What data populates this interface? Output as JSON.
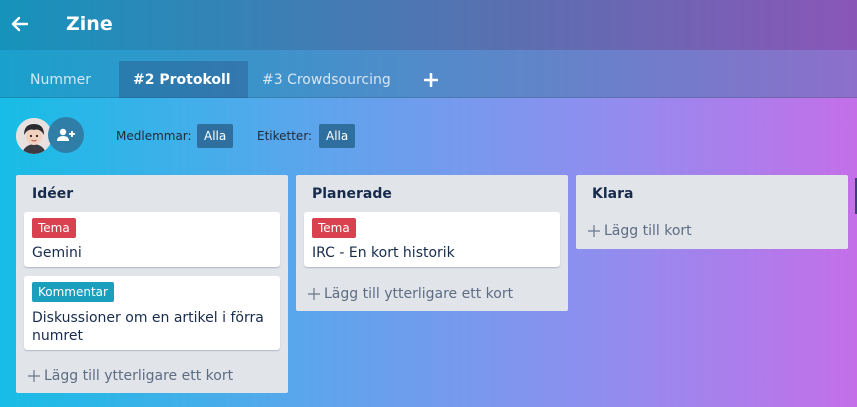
{
  "header": {
    "title": "Zine"
  },
  "tabs": [
    {
      "label": "Nummer",
      "active": false
    },
    {
      "label": "#2 Protokoll",
      "active": true
    },
    {
      "label": "#3 Crowdsourcing",
      "active": false
    }
  ],
  "filters": {
    "members_label": "Medlemmar:",
    "members_value": "Alla",
    "labels_label": "Etiketter:",
    "labels_value": "Alla"
  },
  "lists": [
    {
      "title": "Idéer",
      "cards": [
        {
          "label": "Tema",
          "label_color": "#d9414f",
          "title": "Gemini"
        },
        {
          "label": "Kommentar",
          "label_color": "#1a9fbd",
          "title": "Diskussioner om en artikel i förra numret"
        }
      ],
      "add_label": "Lägg till ytterligare ett kort"
    },
    {
      "title": "Planerade",
      "cards": [
        {
          "label": "Tema",
          "label_color": "#d9414f",
          "title": "IRC - En kort historik"
        }
      ],
      "add_label": "Lägg till ytterligare ett kort"
    },
    {
      "title": "Klara",
      "cards": [],
      "add_label": "Lägg till kort"
    }
  ]
}
